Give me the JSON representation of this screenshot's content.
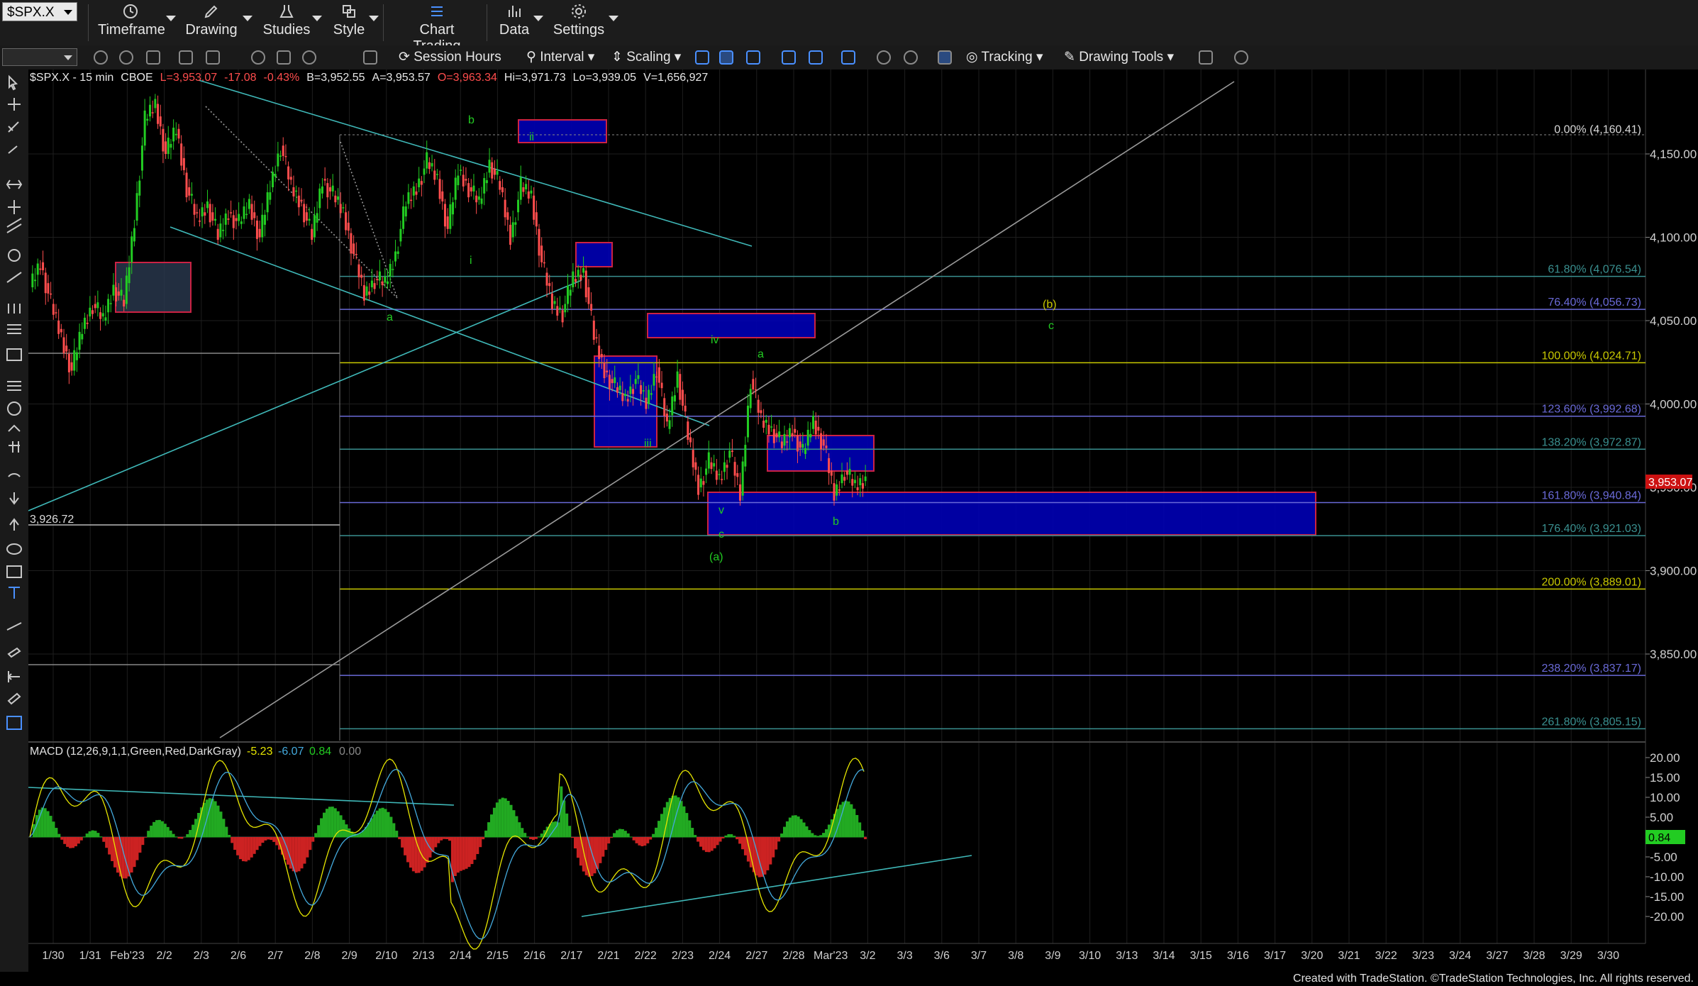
{
  "toolbar": {
    "symbol": "$SPX.X",
    "menus": [
      {
        "label": "Timeframe",
        "icon": "clock-icon"
      },
      {
        "label": "Drawing",
        "icon": "pen-icon"
      },
      {
        "label": "Studies",
        "icon": "flask-icon"
      },
      {
        "label": "Style",
        "icon": "style-icon"
      },
      {
        "label": "Chart Trading",
        "icon": "chart-trading-icon"
      },
      {
        "label": "Data",
        "icon": "data-icon"
      },
      {
        "label": "Settings",
        "icon": "gear-icon"
      }
    ],
    "row2": {
      "session_hours": "Session Hours",
      "interval": "Interval",
      "scaling": "Scaling",
      "tracking": "Tracking",
      "drawing_tools": "Drawing Tools"
    }
  },
  "header": {
    "title": "$SPX.X - 15 min",
    "exchange": "CBOE",
    "last": "L=3,953.07",
    "chg": "-17.08",
    "pct": "-0.43%",
    "bid": "B=3,952.55",
    "ask": "A=3,953.57",
    "open": "O=3,963.34",
    "high": "Hi=3,971.73",
    "low": "Lo=3,939.05",
    "vol": "V=1,656,927"
  },
  "colors": {
    "up": "#22cc22",
    "down": "#ff4d4d",
    "box": "#0000b4",
    "fib_teal": "#3a9090",
    "fib_blue": "#6a6ad8",
    "fib_yellow": "#c8c800"
  },
  "chart_data": {
    "type": "candlestick",
    "y_ticks": [
      "4,150.00",
      "4,100.00",
      "4,050.00",
      "4,000.00",
      "3,950.00",
      "3,900.00",
      "3,850.00"
    ],
    "ylim": [
      3795,
      4185
    ],
    "last_price_tag": "3,953.07",
    "left_label": "3,926.72",
    "x_labels": [
      "1/30",
      "1/31",
      "Feb'23",
      "2/2",
      "2/3",
      "2/6",
      "2/7",
      "2/8",
      "2/9",
      "2/10",
      "2/13",
      "2/14",
      "2/15",
      "2/16",
      "2/17",
      "2/21",
      "2/22",
      "2/23",
      "2/24",
      "2/27",
      "2/28",
      "Mar'23",
      "3/2",
      "3/3",
      "3/6",
      "3/7",
      "3/8",
      "3/9",
      "3/10",
      "3/13",
      "3/14",
      "3/15",
      "3/16",
      "3/17",
      "3/20",
      "3/21",
      "3/22",
      "3/23",
      "3/24",
      "3/27",
      "3/28",
      "3/29",
      "3/30"
    ],
    "fib_levels": [
      {
        "label": "0.00% (4,160.41)",
        "value": 4160.41,
        "color": "#bbbbbb"
      },
      {
        "label": "61.80% (4,076.54)",
        "value": 4076.54,
        "color": "#3a9090"
      },
      {
        "label": "76.40% (4,056.73)",
        "value": 4056.73,
        "color": "#6a6ad8"
      },
      {
        "label": "100.00% (4,024.71)",
        "value": 4024.71,
        "color": "#c8c800"
      },
      {
        "label": "123.60% (3,992.68)",
        "value": 3992.68,
        "color": "#6a6ad8"
      },
      {
        "label": "138.20% (3,972.87)",
        "value": 3972.87,
        "color": "#3a9090"
      },
      {
        "label": "161.80% (3,940.84)",
        "value": 3940.84,
        "color": "#6a6ad8"
      },
      {
        "label": "176.40% (3,921.03)",
        "value": 3921.03,
        "color": "#3a9090"
      },
      {
        "label": "200.00% (3,889.01)",
        "value": 3889.01,
        "color": "#c8c800"
      },
      {
        "label": "238.20% (3,837.17)",
        "value": 3837.17,
        "color": "#6a6ad8"
      },
      {
        "label": "261.80% (3,805.15)",
        "value": 3805.15,
        "color": "#3a9090"
      }
    ],
    "wave_labels": [
      "b",
      "ii",
      "i",
      "a",
      "iv",
      "a",
      "iii",
      "v",
      "c",
      "(a)",
      "b",
      "(b)",
      "c"
    ],
    "price_path": [
      4070,
      4085,
      4060,
      4040,
      4020,
      4045,
      4060,
      4050,
      4070,
      4060,
      4110,
      4170,
      4180,
      4150,
      4165,
      4130,
      4110,
      4120,
      4100,
      4115,
      4108,
      4120,
      4100,
      4130,
      4155,
      4130,
      4120,
      4100,
      4135,
      4125,
      4115,
      4090,
      4065,
      4075,
      4072,
      4090,
      4120,
      4130,
      4145,
      4135,
      4105,
      4140,
      4130,
      4120,
      4145,
      4130,
      4100,
      4130,
      4125,
      4085,
      4060,
      4055,
      4075,
      4080,
      4040,
      4020,
      4010,
      4003,
      4015,
      4000,
      4022,
      3985,
      4018,
      3980,
      3950,
      3965,
      3955,
      3972,
      3945,
      4015,
      3990,
      3985,
      3975,
      3985,
      3970,
      3990,
      3975,
      3945,
      3960,
      3950,
      3955
    ],
    "macd": {
      "label": "MACD (12,26,9,1,1,Green,Red,DarkGray)",
      "values": [
        "-5.23",
        "-6.07",
        "0.84",
        "0.00"
      ],
      "y_ticks": [
        "20.00",
        "15.00",
        "10.00",
        "5.00",
        "-5.00",
        "-10.00",
        "-15.00",
        "-20.00"
      ],
      "last_tag": "0.84"
    }
  },
  "footer": {
    "credit": "Created with TradeStation. ©TradeStation Technologies, Inc. All rights reserved."
  }
}
